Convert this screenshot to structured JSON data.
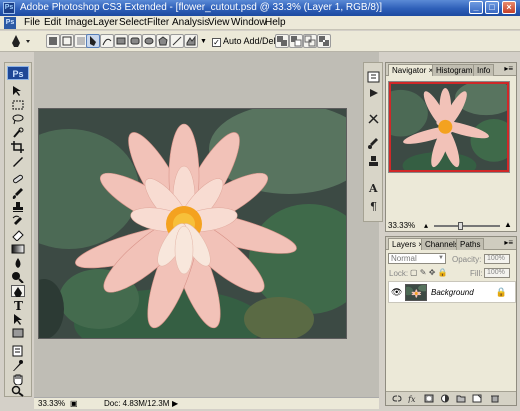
{
  "window": {
    "title": "Adobe Photoshop CS3 Extended - [flower_cutout.psd @ 33.3% (Layer 1, RGB/8)]",
    "logo_text": "Ps"
  },
  "menu": [
    "File",
    "Edit",
    "Image",
    "Layer",
    "Select",
    "Filter",
    "Analysis",
    "View",
    "Window",
    "Help"
  ],
  "options_bar": {
    "auto_add_delete_label": "Auto Add/Delete",
    "auto_add_delete_checked": true
  },
  "toolbox": {
    "logo": "Ps",
    "tools": [
      "move-tool-icon",
      "marquee-tool-icon",
      "lasso-tool-icon",
      "quick-select-tool-icon",
      "crop-tool-icon",
      "slice-tool-icon",
      "healing-brush-icon",
      "brush-tool-icon",
      "clone-stamp-icon",
      "history-brush-icon",
      "eraser-tool-icon",
      "gradient-tool-icon",
      "blur-tool-icon",
      "dodge-tool-icon",
      "pen-tool-icon",
      "type-tool-icon",
      "path-select-icon",
      "shape-tool-icon",
      "notes-tool-icon",
      "eyedropper-icon",
      "hand-tool-icon",
      "zoom-tool-icon"
    ]
  },
  "navigator_panel": {
    "tabs": [
      "Navigator",
      "Histogram",
      "Info"
    ],
    "active_tab": "Navigator",
    "zoom": "33.33%"
  },
  "layers_panel": {
    "tabs": [
      "Layers",
      "Channels",
      "Paths"
    ],
    "active_tab": "Layers",
    "blend_mode": "Normal",
    "opacity_label": "Opacity:",
    "opacity_value": "100%",
    "lock_label": "Lock:",
    "fill_label": "Fill:",
    "fill_value": "100%",
    "layers": [
      {
        "name": "Background",
        "visible": true,
        "locked": true
      }
    ]
  },
  "status_bar": {
    "zoom": "33.33%",
    "doc_size": "Doc: 4.83M/12.3M"
  },
  "colors": {
    "titlebar": "#2d5fb8",
    "panel_bg": "#ece9d8",
    "workspace": "#bfbdb5",
    "navigator_view_box": "#d02828"
  }
}
